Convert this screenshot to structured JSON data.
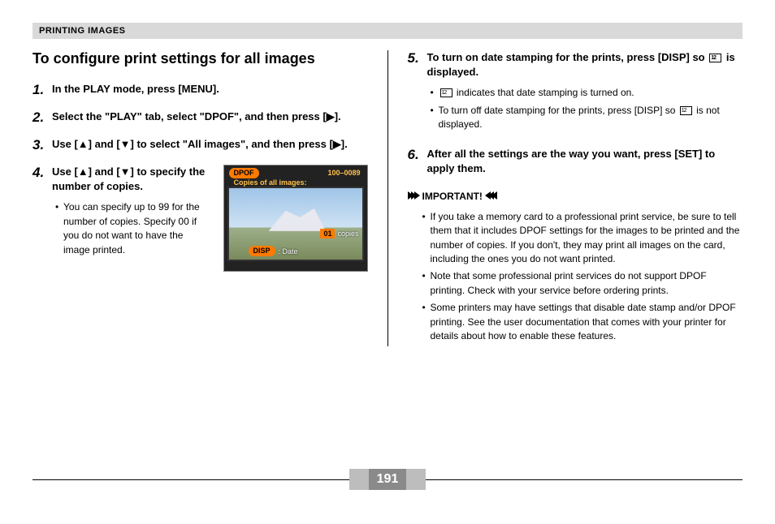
{
  "header": "PRINTING IMAGES",
  "page_number": "191",
  "left": {
    "title": "To configure print settings for all images",
    "steps": [
      {
        "num": "1.",
        "text": "In the PLAY mode, press [MENU]."
      },
      {
        "num": "2.",
        "text": "Select the \"PLAY\" tab, select \"DPOF\", and then press [▶]."
      },
      {
        "num": "3.",
        "text": "Use [▲] and [▼] to select \"All images\", and then press [▶]."
      },
      {
        "num": "4.",
        "text": "Use [▲] and [▼] to specify the number of copies.",
        "sub": [
          "You can specify up to 99 for the number of copies. Specify 00 if you do not want to have the image printed."
        ]
      }
    ],
    "lcd": {
      "dpof": "DPOF",
      "file_no": "100–0089",
      "copies_title": "Copies of all images:",
      "copies_num": "01",
      "copies_label": "copies",
      "disp": "DISP",
      "date": ": Date"
    }
  },
  "right": {
    "steps": [
      {
        "num": "5.",
        "text_a": "To turn on date stamping for the prints, press [DISP] so ",
        "text_b": " is displayed.",
        "sub_a_pre": "",
        "sub_a_post": " indicates that date stamping is turned on.",
        "sub_b_pre": "To turn off date stamping for the prints, press [DISP] so ",
        "sub_b_post": " is not displayed."
      },
      {
        "num": "6.",
        "text": "After all the settings are the way you want, press [SET] to apply them."
      }
    ],
    "important_label": "IMPORTANT!",
    "important_items": [
      "If you take a memory card to a professional print service, be sure to tell them that it includes DPOF settings for the images to be printed and the number of copies. If you don't, they may print all images on the card, including the ones you do not want printed.",
      "Note that some professional print services do not support DPOF printing. Check with your service before ordering prints.",
      "Some printers may have settings that disable date stamp and/or DPOF printing. See the user documentation that comes with your printer for details about how to enable these features."
    ]
  }
}
